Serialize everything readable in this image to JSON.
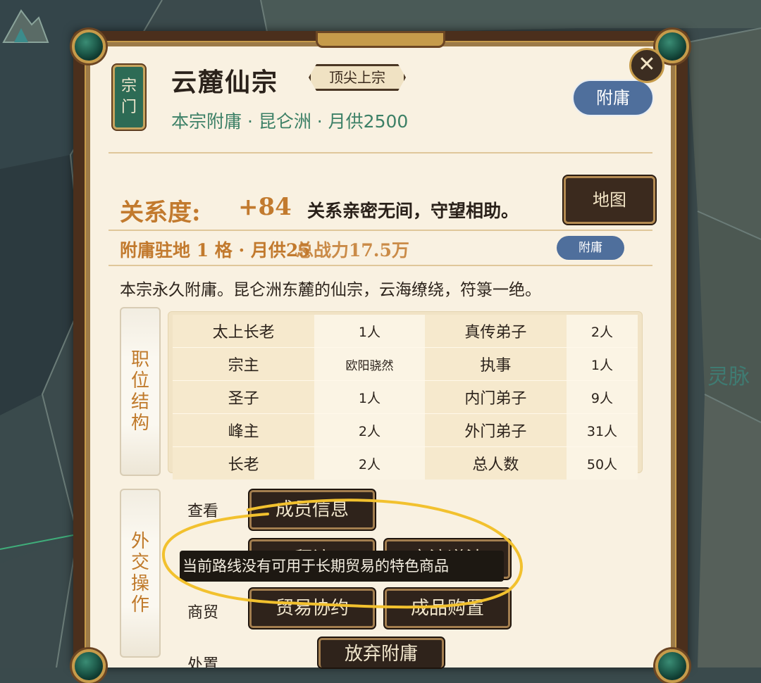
{
  "map": {
    "region_label": "灵脉"
  },
  "header": {
    "seal_chars": [
      "宗",
      "门"
    ],
    "sect_name": "云麓仙宗",
    "rank": "顶尖上宗",
    "subtitle": "本宗附庸 · 昆仑洲 · 月供2500",
    "vassal_button": "附庸",
    "close_icon": "✕"
  },
  "relation": {
    "label": "关系度:",
    "value": "+84",
    "description": "关系亲密无间，守望相助。",
    "map_button": "地图",
    "overlap_line_a": "附庸驻地 1 格 · 月供25",
    "overlap_line_b": "总战力17.5万",
    "small_badge": "附庸",
    "intro": "本宗永久附庸。昆仑洲东麓的仙宗，云海缭绕，符箓一绝。"
  },
  "structure": {
    "tag_chars": [
      "职",
      "位",
      "结",
      "构"
    ],
    "rows": [
      {
        "l1": "太上长老",
        "v1": "1人",
        "l2": "真传弟子",
        "v2": "2人"
      },
      {
        "l1": "宗主",
        "v1": "欧阳骁然",
        "l2": "执事",
        "v2": "1人"
      },
      {
        "l1": "圣子",
        "v1": "1人",
        "l2": "内门弟子",
        "v2": "9人"
      },
      {
        "l1": "峰主",
        "v1": "2人",
        "l2": "外门弟子",
        "v2": "31人"
      },
      {
        "l1": "长老",
        "v1": "2人",
        "l2": "总人数",
        "v2": "50人"
      }
    ]
  },
  "diplomacy": {
    "tag_chars": [
      "外",
      "交",
      "操",
      "作"
    ],
    "view_label": "查看",
    "member_info_button": "成员信息",
    "row2_label": "来往",
    "visit_button": "拜访",
    "exchange_button": "交流道法",
    "tooltip": "当前路线没有可用于长期贸易的特色商品",
    "trade_label": "商贸",
    "trade_pact_button": "贸易协约",
    "purchase_button": "成品购置",
    "abandon_label": "处置",
    "abandon_button": "放弃附庸"
  },
  "colors": {
    "accent_orange": "#c27a2e",
    "accent_green": "#3c8066",
    "button_blue": "#4f6f9c",
    "annotation_yellow": "#f2c12e"
  }
}
